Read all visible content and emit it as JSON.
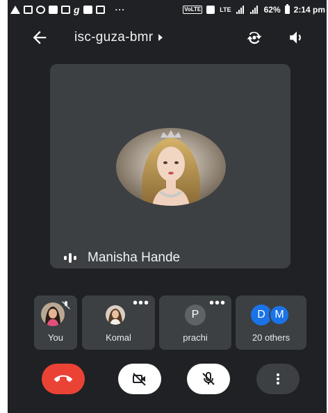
{
  "status_bar": {
    "left_icons": [
      "warning-icon",
      "cast-icon",
      "whatsapp-icon",
      "facebook-icon",
      "gallery-icon",
      "g-icon",
      "video-icon",
      "image-icon"
    ],
    "overflow": "···",
    "volte": "VoLTE",
    "lte": "LTE",
    "battery": "62%",
    "time": "2:14 pm"
  },
  "app_bar": {
    "meeting_code": "isc-guza-bmr"
  },
  "main_tile": {
    "speaker_name": "Manisha Hande"
  },
  "participants": [
    {
      "label": "You",
      "muted": true
    },
    {
      "label": "Komal",
      "has_more": true
    },
    {
      "label": "prachi",
      "initial": "P",
      "has_more": true
    },
    {
      "label": "20 others",
      "initials": [
        "D",
        "M"
      ]
    }
  ],
  "colors": {
    "background": "#202124",
    "tile": "#3c4043",
    "end_call": "#ea4335",
    "avatar_blue": "#1a73e8",
    "avatar_grey": "#5f6368"
  }
}
